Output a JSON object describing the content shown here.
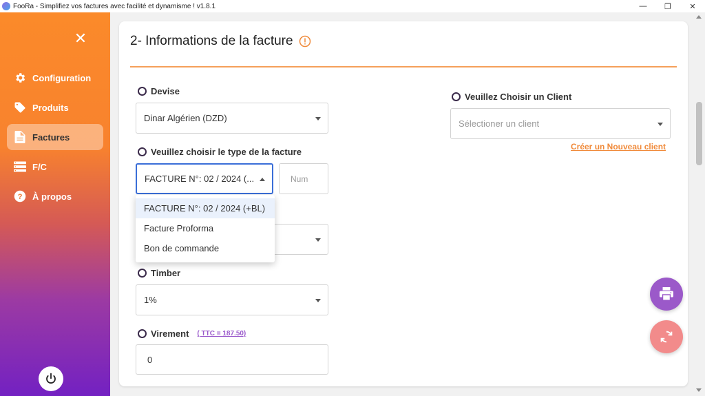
{
  "window": {
    "title": "FooRa - Simplifiez vos factures avec facilité et dynamisme ! v1.8.1"
  },
  "sidebar": {
    "items": [
      {
        "label": "Configuration",
        "icon": "gear-icon"
      },
      {
        "label": "Produits",
        "icon": "tag-icon"
      },
      {
        "label": "Factures",
        "icon": "document-icon",
        "active": true
      },
      {
        "label": "F/C",
        "icon": "list-icon"
      },
      {
        "label": "À propos",
        "icon": "help-icon"
      }
    ]
  },
  "page": {
    "title": "2- Informations de la facture",
    "devise": {
      "label": "Devise",
      "value": "Dinar Algérien (DZD)"
    },
    "type_facture": {
      "label": "Veuillez choisir le type de la facture",
      "value": "FACTURE N°: 02 / 2024 (...",
      "num_placeholder": "Num",
      "options": [
        "FACTURE N°: 02 / 2024 (+BL)",
        "Facture Proforma",
        "Bon de commande"
      ]
    },
    "timber": {
      "label": "Timber",
      "value": "1%"
    },
    "virement": {
      "label": "Virement",
      "note": "( TTC = 187.50)",
      "value": "0"
    },
    "client": {
      "label": "Veuillez Choisir un Client",
      "placeholder": "Sélectioner un client",
      "create_link": "Créer un Nouveau client"
    }
  },
  "colors": {
    "accent_orange": "#f08a3a",
    "print_fab": "#9b59c9",
    "refresh_fab": "#f28b8b",
    "focus_blue": "#3a6ed8"
  }
}
